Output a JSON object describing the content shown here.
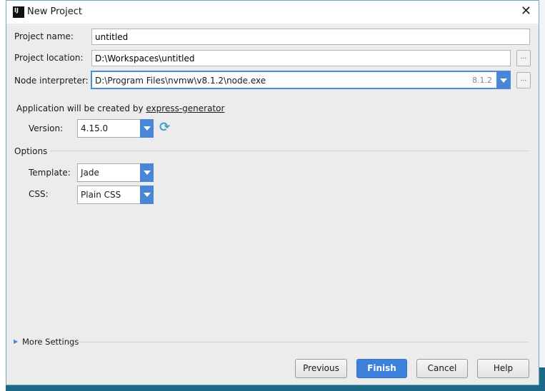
{
  "window": {
    "title": "New Project",
    "close_icon": "close-icon"
  },
  "form": {
    "project_name": {
      "label": "Project name:",
      "value": "untitled"
    },
    "project_location": {
      "label": "Project location:",
      "value": "D:\\Workspaces\\untitled",
      "browse": "..."
    },
    "node_interpreter": {
      "label": "Node interpreter:",
      "value": "D:\\Program Files\\nvmw\\v8.1.2\\node.exe",
      "version": "8.1.2",
      "browse": "..."
    }
  },
  "generator": {
    "text": "Application will be created by",
    "link": "express-generator",
    "version_label": "Version:",
    "version": "4.15.0",
    "refresh_icon": "refresh-icon"
  },
  "options": {
    "title": "Options",
    "template_label": "Template:",
    "template": "Jade",
    "css_label": "CSS:",
    "css": "Plain CSS"
  },
  "more_settings": "More Settings",
  "buttons": {
    "previous": "Previous",
    "finish": "Finish",
    "cancel": "Cancel",
    "help": "Help"
  },
  "colors": {
    "accent": "#3d80dc",
    "background": "#ececec"
  }
}
